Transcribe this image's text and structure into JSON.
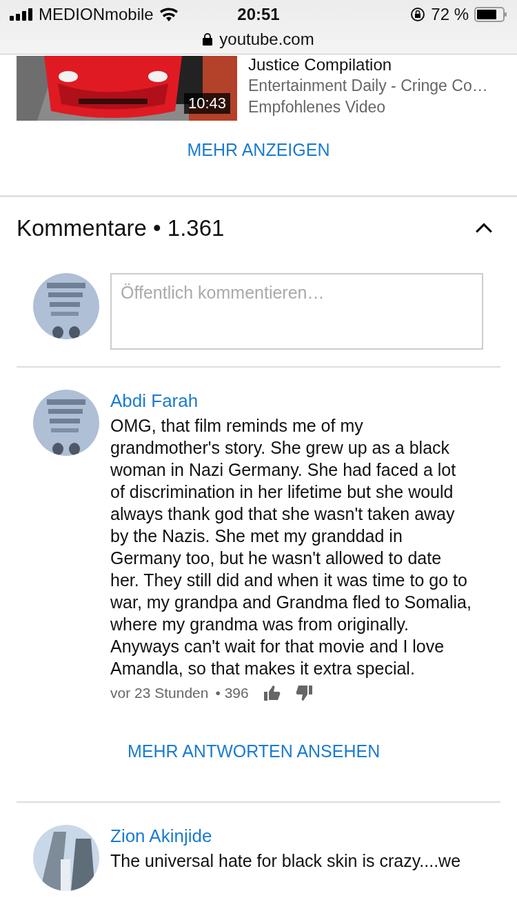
{
  "status_bar": {
    "carrier": "MEDIONmobile",
    "time": "20:51",
    "battery": "72 %"
  },
  "address_bar": {
    "url": "youtube.com"
  },
  "video": {
    "title": "Justice Compilation",
    "channel": "Entertainment Daily - Cringe Co…",
    "label": "Empfohlenes Video",
    "duration": "10:43"
  },
  "show_more": "MEHR ANZEIGEN",
  "comments_header": {
    "title": "Kommentare",
    "separator": "•",
    "count": "1.361",
    "expanded": true
  },
  "comment_input": {
    "placeholder": "Öffentlich kommentieren…"
  },
  "comments": [
    {
      "author": "Abdi Farah",
      "text": "OMG, that film reminds me of my grandmother's story. She grew up as a black woman in Nazi Germany. She had faced a lot of discrimination in her lifetime but she would always thank god that she wasn't taken away by the Nazis. She met my granddad in Germany too, but he wasn't allowed to date her. They still did and when it was time to go to war, my grandpa and Grandma fled to Somalia, where my grandma was from originally. Anyways can't wait for that movie and I love Amandla, so that makes it extra special.",
      "time": "vor 23 Stunden",
      "separator": "•",
      "likes": "396",
      "replies": "MEHR ANTWORTEN ANSEHEN"
    },
    {
      "author": "Zion Akinjide",
      "text": "The universal hate for black skin is crazy....we"
    }
  ]
}
